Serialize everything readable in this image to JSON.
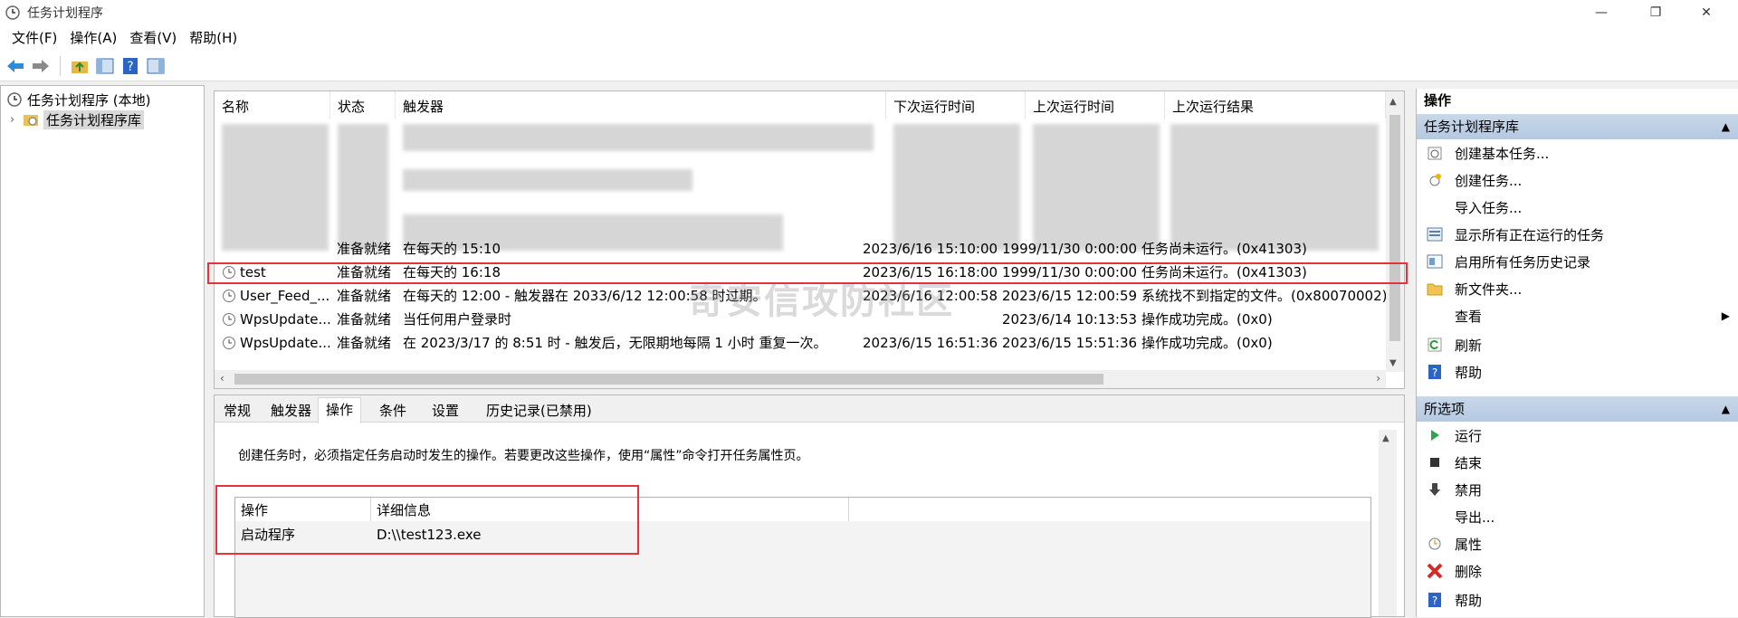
{
  "window": {
    "title": "任务计划程序",
    "minimize": "—",
    "restore": "❐",
    "close": "✕"
  },
  "menu": [
    "文件(F)",
    "操作(A)",
    "查看(V)",
    "帮助(H)"
  ],
  "toolbar": {
    "icons": [
      "back-icon",
      "forward-icon",
      "folder-up-icon",
      "show-hide-console-tree-icon",
      "help-icon",
      "show-hide-action-pane-icon"
    ]
  },
  "tree": {
    "root": "任务计划程序 (本地)",
    "library": "任务计划程序库",
    "expander": "›"
  },
  "tasklist": {
    "columns": [
      "名称",
      "状态",
      "触发器",
      "下次运行时间",
      "上次运行时间",
      "上次运行结果"
    ],
    "rows": [
      {
        "name": "",
        "status": "准备就绪",
        "trigger": "在每天的 15:10",
        "next": "2023/6/16 15:10:00",
        "last": "1999/11/30 0:00:00",
        "result": "任务尚未运行。(0x41303)"
      },
      {
        "name": "test",
        "status": "准备就绪",
        "trigger": "在每天的 16:18",
        "next": "2023/6/15 16:18:00",
        "last": "1999/11/30 0:00:00",
        "result": "任务尚未运行。(0x41303)"
      },
      {
        "name": "User_Feed_...",
        "status": "准备就绪",
        "trigger": "在每天的 12:00 - 触发器在 2033/6/12 12:00:58 时过期。",
        "next": "2023/6/16 12:00:58",
        "last": "2023/6/15 12:00:59",
        "result": "系统找不到指定的文件。(0x80070002)"
      },
      {
        "name": "WpsUpdate...",
        "status": "准备就绪",
        "trigger": "当任何用户登录时",
        "next": "",
        "last": "2023/6/14 10:13:53",
        "result": "操作成功完成。(0x0)"
      },
      {
        "name": "WpsUpdate...",
        "status": "准备就绪",
        "trigger": "在 2023/3/17 的 8:51 时 - 触发后，无限期地每隔 1 小时 重复一次。",
        "next": "2023/6/15 16:51:36",
        "last": "2023/6/15 15:51:36",
        "result": "操作成功完成。(0x0)"
      }
    ],
    "watermark": "奇安信攻防社区"
  },
  "details": {
    "tabs": [
      "常规",
      "触发器",
      "操作",
      "条件",
      "设置",
      "历史记录(已禁用)"
    ],
    "active_tab": "操作",
    "description": "创建任务时，必须指定任务启动时发生的操作。若要更改这些操作，使用“属性”命令打开任务属性页。",
    "table_headers": [
      "操作",
      "详细信息"
    ],
    "table_rows": [
      {
        "action": "启动程序",
        "detail": "D:\\\\test123.exe"
      }
    ]
  },
  "actions_pane": {
    "title": "操作",
    "section1": "任务计划程序库",
    "section1_items": [
      {
        "label": "创建基本任务...",
        "icon": "create-basic-task-icon"
      },
      {
        "label": "创建任务...",
        "icon": "create-task-icon"
      },
      {
        "label": "导入任务...",
        "icon": ""
      },
      {
        "label": "显示所有正在运行的任务",
        "icon": "running-tasks-icon"
      },
      {
        "label": "启用所有任务历史记录",
        "icon": "history-icon"
      },
      {
        "label": "新文件夹...",
        "icon": "folder-icon"
      },
      {
        "label": "查看",
        "icon": ""
      },
      {
        "label": "刷新",
        "icon": "refresh-icon"
      },
      {
        "label": "帮助",
        "icon": "help-icon"
      }
    ],
    "section2": "所选项",
    "section2_items": [
      {
        "label": "运行",
        "icon": "run-icon"
      },
      {
        "label": "结束",
        "icon": "end-icon"
      },
      {
        "label": "禁用",
        "icon": "disable-icon"
      },
      {
        "label": "导出...",
        "icon": ""
      },
      {
        "label": "属性",
        "icon": "properties-icon"
      },
      {
        "label": "删除",
        "icon": "delete-icon"
      },
      {
        "label": "帮助",
        "icon": "help-icon"
      }
    ],
    "collapse_arrow": "▲",
    "submenu_arrow": "▶"
  },
  "colors": {
    "accent_red": "#e8323b",
    "section_blue": "#bccfe5"
  }
}
